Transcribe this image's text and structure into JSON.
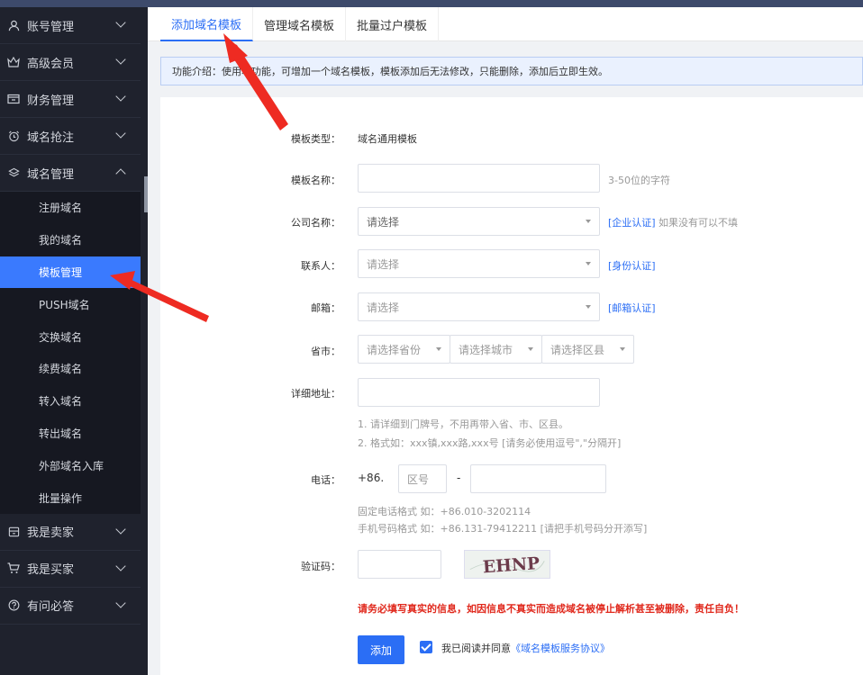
{
  "sidebar": {
    "menus_top": [
      {
        "label": "账号管理",
        "icon": "user-icon"
      },
      {
        "label": "高级会员",
        "icon": "crown-icon"
      },
      {
        "label": "财务管理",
        "icon": "wallet-icon"
      },
      {
        "label": "域名抢注",
        "icon": "alarm-clock-icon"
      },
      {
        "label": "域名管理",
        "icon": "layers-icon"
      }
    ],
    "submenu": [
      "注册域名",
      "我的域名",
      "模板管理",
      "PUSH域名",
      "交换域名",
      "续费域名",
      "转入域名",
      "转出域名",
      "外部域名入库",
      "批量操作"
    ],
    "active_submenu": "模板管理",
    "menus_bottom": [
      {
        "label": "我是卖家",
        "icon": "store-icon"
      },
      {
        "label": "我是买家",
        "icon": "cart-icon"
      },
      {
        "label": "有问必答",
        "icon": "question-icon"
      }
    ]
  },
  "tabs": [
    {
      "label": "添加域名模板",
      "active": true
    },
    {
      "label": "管理域名模板",
      "active": false
    },
    {
      "label": "批量过户模板",
      "active": false
    }
  ],
  "notice": "功能介绍：使用本功能，可增加一个域名模板，模板添加后无法修改，只能删除，添加后立即生效。",
  "form": {
    "template_type": {
      "label": "模板类型：",
      "value": "域名通用模板"
    },
    "template_name": {
      "label": "模板名称：",
      "value": "",
      "hint": "3-50位的字符"
    },
    "company": {
      "label": "公司名称：",
      "value": "请选择",
      "link": "[企业认证]",
      "hint": "如果没有可以不填"
    },
    "contact": {
      "label": "联系人：",
      "value": "请选择",
      "link": "[身份认证]"
    },
    "email": {
      "label": "邮箱：",
      "value": "请选择",
      "link": "[邮箱认证]"
    },
    "region": {
      "label": "省市：",
      "province": "请选择省份",
      "city": "请选择城市",
      "district": "请选择区县"
    },
    "address": {
      "label": "详细地址：",
      "value": "",
      "hint1": "1. 请详细到门牌号，不用再带入省、市、区县。",
      "hint2": "2. 格式如：xxx镇,xxx路,xxx号 [请务必使用逗号\",\"分隔开]"
    },
    "phone": {
      "label": "电话：",
      "prefix": "+86.",
      "area_placeholder": "区号",
      "dash": "-",
      "value": "",
      "hint1": "固定电话格式 如：+86.010-3202114",
      "hint2": "手机号码格式 如：+86.131-79412211 [请把手机号码分开添写]"
    },
    "captcha": {
      "label": "验证码：",
      "value": "",
      "image_text": "EHNP"
    },
    "warning": "请务必填写真实的信息，如因信息不真实而造成域名被停止解析甚至被删除，责任自负！",
    "submit": "添加",
    "agree": {
      "checked": true,
      "text": "我已阅读并同意",
      "link": "《域名模板服务协议》"
    }
  },
  "colors": {
    "accent": "#2b6ef5",
    "sidebar": "#1f222d",
    "warning": "#e0281c",
    "annotation_arrow": "#ee2b22"
  }
}
